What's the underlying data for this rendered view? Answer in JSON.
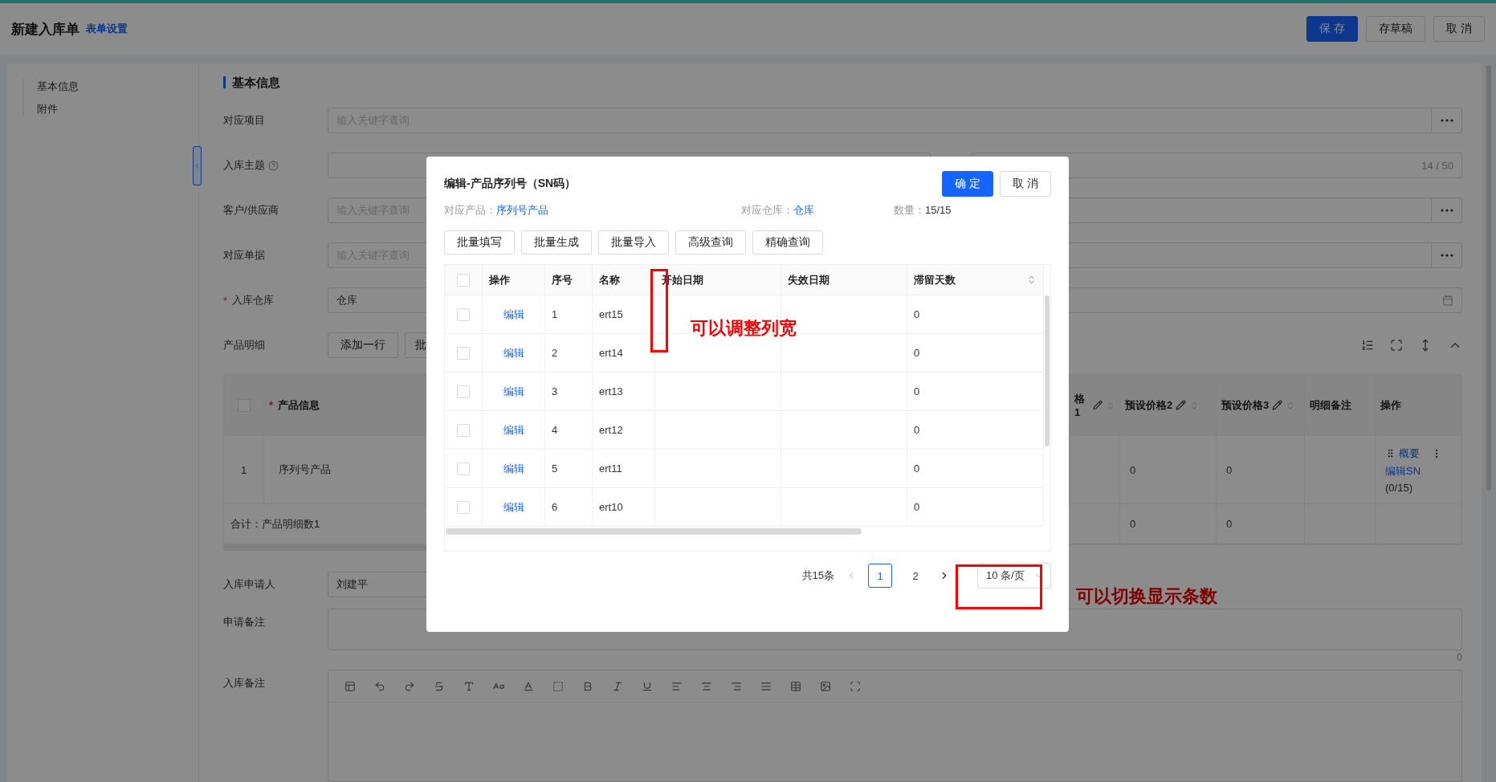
{
  "header": {
    "title": "新建入库单",
    "link": "表单设置",
    "buttons": [
      {
        "label": "保 存",
        "kind": "primary"
      },
      {
        "label": "存草稿",
        "kind": "default"
      },
      {
        "label": "取 消",
        "kind": "default"
      }
    ]
  },
  "sidebar": {
    "items": [
      {
        "label": "基本信息"
      },
      {
        "label": "附件"
      }
    ]
  },
  "section_title": "基本信息",
  "fields": [
    {
      "label": "对应项目",
      "kind": "picker",
      "help": false,
      "placeholder": "输入关键字查询"
    },
    {
      "label": "入库主题",
      "kind": "split",
      "help": true,
      "counter": "14 / 50"
    },
    {
      "label": "客户/供应商",
      "kind": "picker",
      "help": false,
      "placeholder": "输入关键字查询"
    },
    {
      "label": "对应单据",
      "kind": "picker",
      "help": false,
      "placeholder": "输入关键字查询"
    },
    {
      "label": "入库仓库",
      "kind": "date",
      "required_mark": "*",
      "help": false,
      "value": "仓库"
    }
  ],
  "product_detail": {
    "label": "产品明细",
    "buttons": [
      "添加一行",
      "批"
    ]
  },
  "product_table": {
    "header_checked": false,
    "columns": [
      {
        "label": "产品信息",
        "required_mark": "*",
        "editable": false,
        "sortable": false
      },
      {
        "label": "格1",
        "editable": true,
        "sortable": true
      },
      {
        "label": "预设价格2",
        "editable": true,
        "sortable": true
      },
      {
        "label": "预设价格3",
        "editable": true,
        "sortable": true
      },
      {
        "label": "明细备注",
        "editable": false,
        "sortable": false
      },
      {
        "label": "操作",
        "editable": false,
        "sortable": false
      }
    ],
    "rows": [
      {
        "index": "1",
        "cells": [
          "序列号产品",
          "",
          "0",
          "0",
          ""
        ],
        "actions": {
          "link": "概要",
          "edit_link": "编辑SN",
          "count": "(0/15)"
        }
      }
    ],
    "summary": {
      "label": "合计：产品明细数1",
      "values": [
        "0",
        "0"
      ]
    }
  },
  "applicant": {
    "label": "入库申请人",
    "value": "刘建平"
  },
  "apply_note": {
    "label": "申请备注",
    "counter": "0"
  },
  "inbound_note": {
    "label": "入库备注"
  },
  "dialog": {
    "title": "编辑-产品序列号（SN码）",
    "buttons": [
      {
        "label": "确 定",
        "kind": "primary"
      },
      {
        "label": "取 消",
        "kind": "default"
      }
    ],
    "info": [
      {
        "label": "对应产品：",
        "value": "序列号产品",
        "kind": "link"
      },
      {
        "label": "对应仓库：",
        "value": "仓库",
        "kind": "link"
      },
      {
        "label": "数量：",
        "value": "15/15",
        "kind": "text"
      }
    ],
    "tools": [
      "批量填写",
      "批量生成",
      "批量导入",
      "高级查询",
      "精确查询"
    ],
    "table": {
      "header_checked": false,
      "columns": [
        {
          "label": "操作",
          "sortable": false
        },
        {
          "label": "序号",
          "sortable": false
        },
        {
          "label": "名称",
          "sortable": false
        },
        {
          "label": "开始日期",
          "sortable": false
        },
        {
          "label": "失效日期",
          "sortable": false
        },
        {
          "label": "滞留天数",
          "sortable": true
        }
      ],
      "rows": [
        {
          "checked": false,
          "cells": [
            "编辑",
            "1",
            "ert15",
            "",
            "",
            "0"
          ]
        },
        {
          "checked": false,
          "cells": [
            "编辑",
            "2",
            "ert14",
            "",
            "",
            "0"
          ]
        },
        {
          "checked": false,
          "cells": [
            "编辑",
            "3",
            "ert13",
            "",
            "",
            "0"
          ]
        },
        {
          "checked": false,
          "cells": [
            "编辑",
            "4",
            "ert12",
            "",
            "",
            "0"
          ]
        },
        {
          "checked": false,
          "cells": [
            "编辑",
            "5",
            "ert11",
            "",
            "",
            "0"
          ]
        },
        {
          "checked": false,
          "cells": [
            "编辑",
            "6",
            "ert10",
            "",
            "",
            "0"
          ]
        }
      ]
    },
    "pagination": {
      "total": "共15条",
      "pages": [
        {
          "label": "1",
          "selected": true
        },
        {
          "label": "2",
          "selected": false
        }
      ],
      "page_size": "10 条/页"
    }
  },
  "annotations": [
    {
      "text": "可以调整列宽"
    },
    {
      "text": "可以切换显示条数"
    }
  ]
}
